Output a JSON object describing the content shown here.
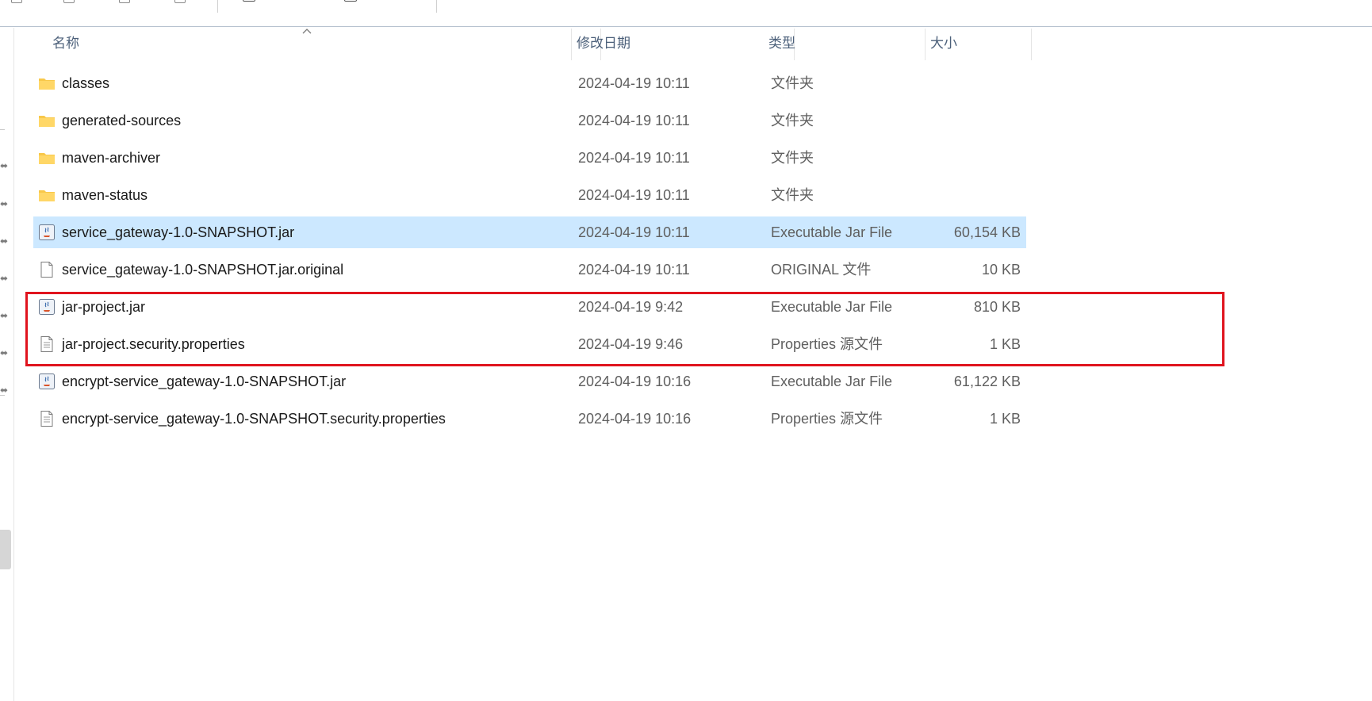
{
  "columns": {
    "name": "名称",
    "modified": "修改日期",
    "type": "类型",
    "size": "大小"
  },
  "files": [
    {
      "name": "classes",
      "modified": "2024-04-19 10:11",
      "type": "文件夹",
      "size": "",
      "icon": "folder-icon"
    },
    {
      "name": "generated-sources",
      "modified": "2024-04-19 10:11",
      "type": "文件夹",
      "size": "",
      "icon": "folder-icon"
    },
    {
      "name": "maven-archiver",
      "modified": "2024-04-19 10:11",
      "type": "文件夹",
      "size": "",
      "icon": "folder-icon"
    },
    {
      "name": "maven-status",
      "modified": "2024-04-19 10:11",
      "type": "文件夹",
      "size": "",
      "icon": "folder-icon"
    },
    {
      "name": "service_gateway-1.0-SNAPSHOT.jar",
      "modified": "2024-04-19 10:11",
      "type": "Executable Jar File",
      "size": "60,154 KB",
      "icon": "java-jar-icon",
      "selected": true
    },
    {
      "name": "service_gateway-1.0-SNAPSHOT.jar.original",
      "modified": "2024-04-19 10:11",
      "type": "ORIGINAL 文件",
      "size": "10 KB",
      "icon": "blank-file-icon"
    },
    {
      "name": "jar-project.jar",
      "modified": "2024-04-19 9:42",
      "type": "Executable Jar File",
      "size": "810 KB",
      "icon": "java-jar-icon"
    },
    {
      "name": "jar-project.security.properties",
      "modified": "2024-04-19 9:46",
      "type": "Properties 源文件",
      "size": "1 KB",
      "icon": "text-file-icon"
    },
    {
      "name": "encrypt-service_gateway-1.0-SNAPSHOT.jar",
      "modified": "2024-04-19 10:16",
      "type": "Executable Jar File",
      "size": "61,122 KB",
      "icon": "java-jar-icon"
    },
    {
      "name": "encrypt-service_gateway-1.0-SNAPSHOT.security.properties",
      "modified": "2024-04-19 10:16",
      "type": "Properties 源文件",
      "size": "1 KB",
      "icon": "text-file-icon"
    }
  ],
  "colors": {
    "selected_row": "#cce8ff",
    "annotation_box": "#e0141e",
    "header_text": "#4c607a",
    "folder": "#f8c84a"
  }
}
